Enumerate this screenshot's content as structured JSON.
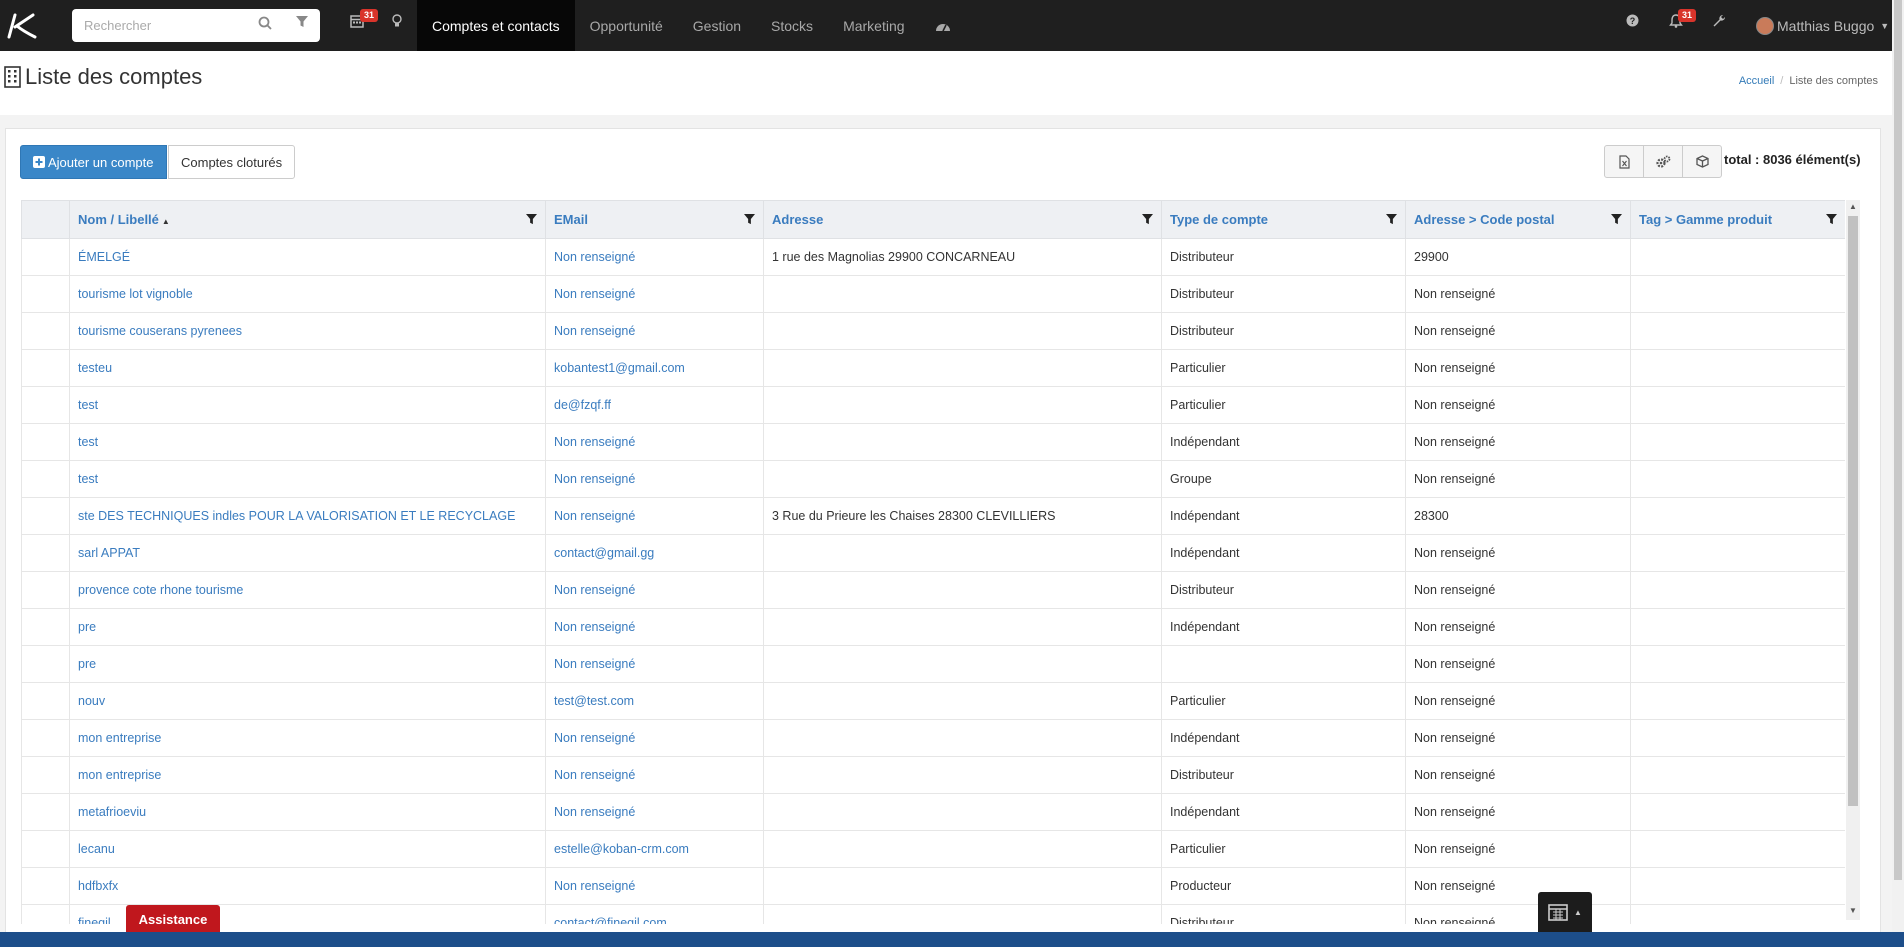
{
  "search": {
    "placeholder": "Rechercher"
  },
  "nav": {
    "calendar_badge": "31",
    "notif_badge": "31",
    "menu": [
      "Comptes et contacts",
      "Opportunité",
      "Gestion",
      "Stocks",
      "Marketing"
    ],
    "user_name": "Matthias Buggo"
  },
  "page": {
    "title": "Liste des comptes",
    "breadcrumb_home": "Accueil",
    "breadcrumb_current": "Liste des comptes"
  },
  "toolbar": {
    "add_label": "Ajouter un compte",
    "closed_label": "Comptes cloturés",
    "total": "total : 8036 élément(s)"
  },
  "table": {
    "columns": [
      "Nom / Libellé",
      "EMail",
      "Adresse",
      "Type de compte",
      "Adresse > Code postal",
      "Tag > Gamme produit"
    ],
    "rows": [
      [
        "ÉMELGÉ",
        "Non renseigné",
        "1 rue des Magnolias 29900 CONCARNEAU",
        "Distributeur",
        "29900",
        ""
      ],
      [
        "tourisme lot vignoble",
        "Non renseigné",
        "",
        "Distributeur",
        "Non renseigné",
        ""
      ],
      [
        "tourisme couserans pyrenees",
        "Non renseigné",
        "",
        "Distributeur",
        "Non renseigné",
        ""
      ],
      [
        "testeu",
        "kobantest1@gmail.com",
        "",
        "Particulier",
        "Non renseigné",
        ""
      ],
      [
        "test",
        "de@fzqf.ff",
        "",
        "Particulier",
        "Non renseigné",
        ""
      ],
      [
        "test",
        "Non renseigné",
        "",
        "Indépendant",
        "Non renseigné",
        ""
      ],
      [
        "test",
        "Non renseigné",
        "",
        "Groupe",
        "Non renseigné",
        ""
      ],
      [
        "ste DES TECHNIQUES indles POUR LA VALORISATION ET LE RECYCLAGE",
        "Non renseigné",
        "3 Rue du Prieure les Chaises 28300 CLEVILLIERS",
        "Indépendant",
        "28300",
        ""
      ],
      [
        "sarl APPAT",
        "contact@gmail.gg",
        "",
        "Indépendant",
        "Non renseigné",
        ""
      ],
      [
        "provence cote rhone tourisme",
        "Non renseigné",
        "",
        "Distributeur",
        "Non renseigné",
        ""
      ],
      [
        "pre",
        "Non renseigné",
        "",
        "Indépendant",
        "Non renseigné",
        ""
      ],
      [
        "pre",
        "Non renseigné",
        "",
        "",
        "Non renseigné",
        ""
      ],
      [
        "nouv",
        "test@test.com",
        "",
        "Particulier",
        "Non renseigné",
        ""
      ],
      [
        "mon entreprise",
        "Non renseigné",
        "",
        "Indépendant",
        "Non renseigné",
        ""
      ],
      [
        "mon entreprise",
        "Non renseigné",
        "",
        "Distributeur",
        "Non renseigné",
        ""
      ],
      [
        "metafrioeviu",
        "Non renseigné",
        "",
        "Indépendant",
        "Non renseigné",
        ""
      ],
      [
        "lecanu",
        "estelle@koban-crm.com",
        "",
        "Particulier",
        "Non renseigné",
        ""
      ],
      [
        "hdfbxfx",
        "Non renseigné",
        "",
        "Producteur",
        "Non renseigné",
        ""
      ],
      [
        "finegil",
        "contact@finegil.com",
        "",
        "Distributeur",
        "Non renseigné",
        ""
      ]
    ]
  },
  "assist": {
    "label": "Assistance"
  },
  "icons": [
    "logo-icon",
    "search-icon",
    "filter-icon",
    "calendar-icon",
    "lightbulb-icon",
    "dashboard-icon",
    "help-icon",
    "bell-icon",
    "wrench-icon",
    "building-icon",
    "plus-icon",
    "excel-icon",
    "gears-icon",
    "cube-icon"
  ]
}
